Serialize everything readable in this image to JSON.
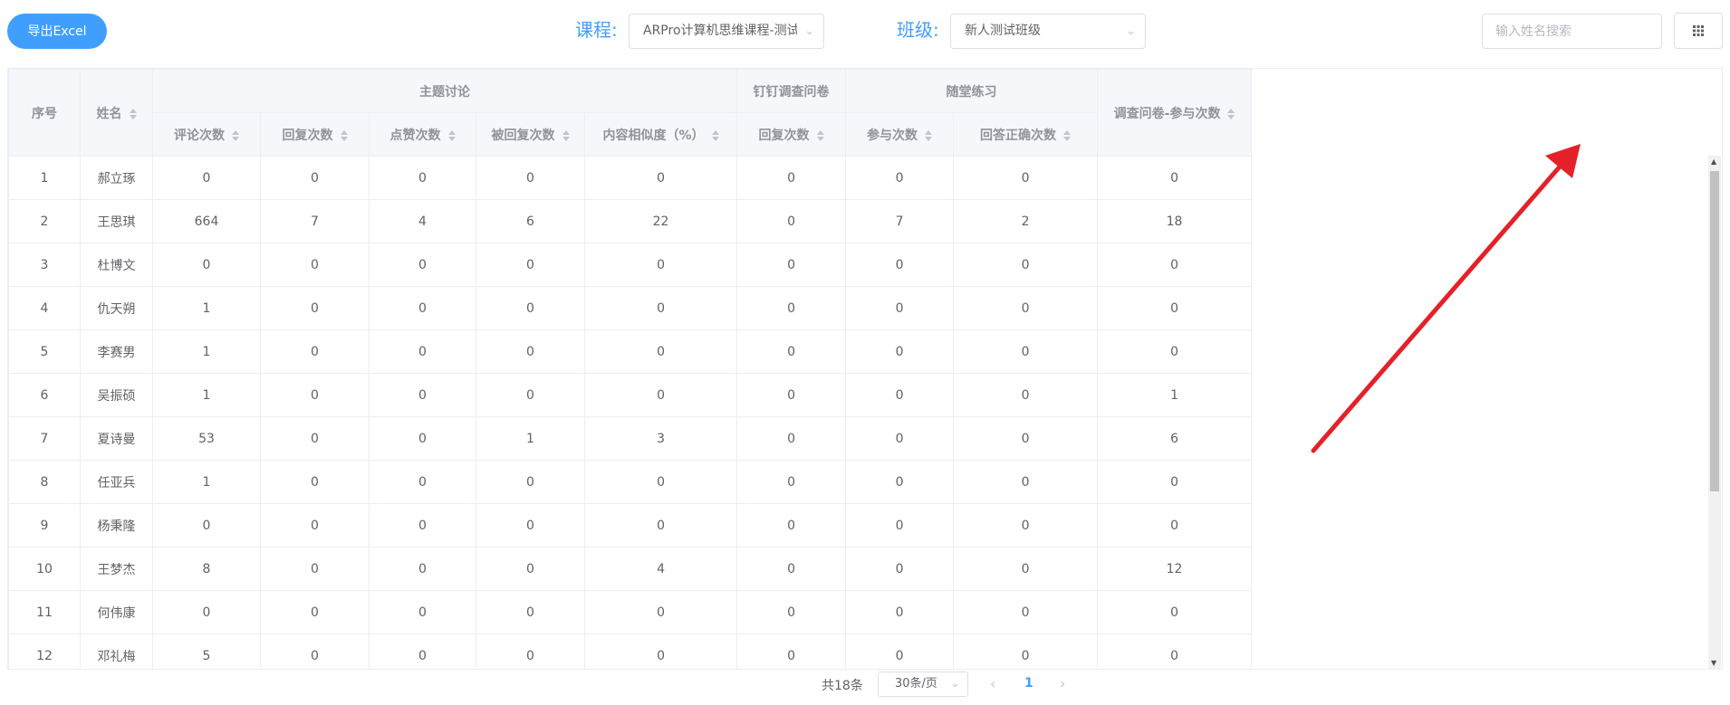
{
  "toolbar": {
    "export_label": "导出Excel",
    "course_label": "课程:",
    "course_value": "ARPro计算机思维课程-测试",
    "class_label": "班级:",
    "class_value": "新人测试班级",
    "search_placeholder": "输入姓名搜索"
  },
  "table": {
    "headers": {
      "index": "序号",
      "name": "姓名",
      "group_topic": "主题讨论",
      "group_dingtalk": "钉钉调查问卷",
      "group_practice": "随堂练习",
      "survey": "调查问卷-参与次数",
      "comment_count": "评论次数",
      "reply_count": "回复次数",
      "like_count": "点赞次数",
      "replied_count": "被回复次数",
      "similarity": "内容相似度（%）",
      "dt_reply_count": "回复次数",
      "join_count": "参与次数",
      "correct_count": "回答正确次数"
    },
    "rows": [
      [
        "1",
        "郝立琢",
        "0",
        "0",
        "0",
        "0",
        "0",
        "0",
        "0",
        "0",
        "0"
      ],
      [
        "2",
        "王思琪",
        "664",
        "7",
        "4",
        "6",
        "22",
        "0",
        "7",
        "2",
        "18"
      ],
      [
        "3",
        "杜博文",
        "0",
        "0",
        "0",
        "0",
        "0",
        "0",
        "0",
        "0",
        "0"
      ],
      [
        "4",
        "仇天朔",
        "1",
        "0",
        "0",
        "0",
        "0",
        "0",
        "0",
        "0",
        "0"
      ],
      [
        "5",
        "李赛男",
        "1",
        "0",
        "0",
        "0",
        "0",
        "0",
        "0",
        "0",
        "0"
      ],
      [
        "6",
        "吴振硕",
        "1",
        "0",
        "0",
        "0",
        "0",
        "0",
        "0",
        "0",
        "1"
      ],
      [
        "7",
        "夏诗曼",
        "53",
        "0",
        "0",
        "1",
        "3",
        "0",
        "0",
        "0",
        "6"
      ],
      [
        "8",
        "任亚兵",
        "1",
        "0",
        "0",
        "0",
        "0",
        "0",
        "0",
        "0",
        "0"
      ],
      [
        "9",
        "杨秉隆",
        "0",
        "0",
        "0",
        "0",
        "0",
        "0",
        "0",
        "0",
        "0"
      ],
      [
        "10",
        "王梦杰",
        "8",
        "0",
        "0",
        "0",
        "4",
        "0",
        "0",
        "0",
        "12"
      ],
      [
        "11",
        "何伟康",
        "0",
        "0",
        "0",
        "0",
        "0",
        "0",
        "0",
        "0",
        "0"
      ],
      [
        "12",
        "邓礼梅",
        "5",
        "0",
        "0",
        "0",
        "0",
        "0",
        "0",
        "0",
        "0"
      ]
    ]
  },
  "pagination": {
    "total": "共18条",
    "page_size": "30条/页",
    "current_page": "1"
  },
  "colors": {
    "accent": "#409eff",
    "annotation": "#e4212a"
  }
}
